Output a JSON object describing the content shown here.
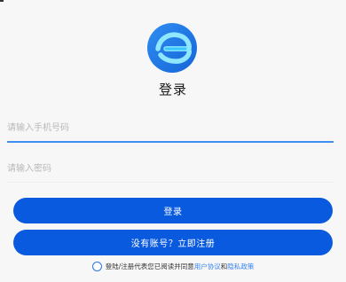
{
  "app": {
    "logo_icon": "app-logo-icon",
    "accent_color": "#0a5ae0"
  },
  "page": {
    "title": "登录"
  },
  "form": {
    "phone_placeholder": "请输入手机号码",
    "password_placeholder": "请输入密码"
  },
  "buttons": {
    "login_label": "登录",
    "register_label": "没有账号？立即注册"
  },
  "agreement": {
    "prefix": "登陆/注册代表您已阅读并同意",
    "user_agreement": "用户协议",
    "and": "和",
    "privacy_policy": "隐私政策"
  }
}
